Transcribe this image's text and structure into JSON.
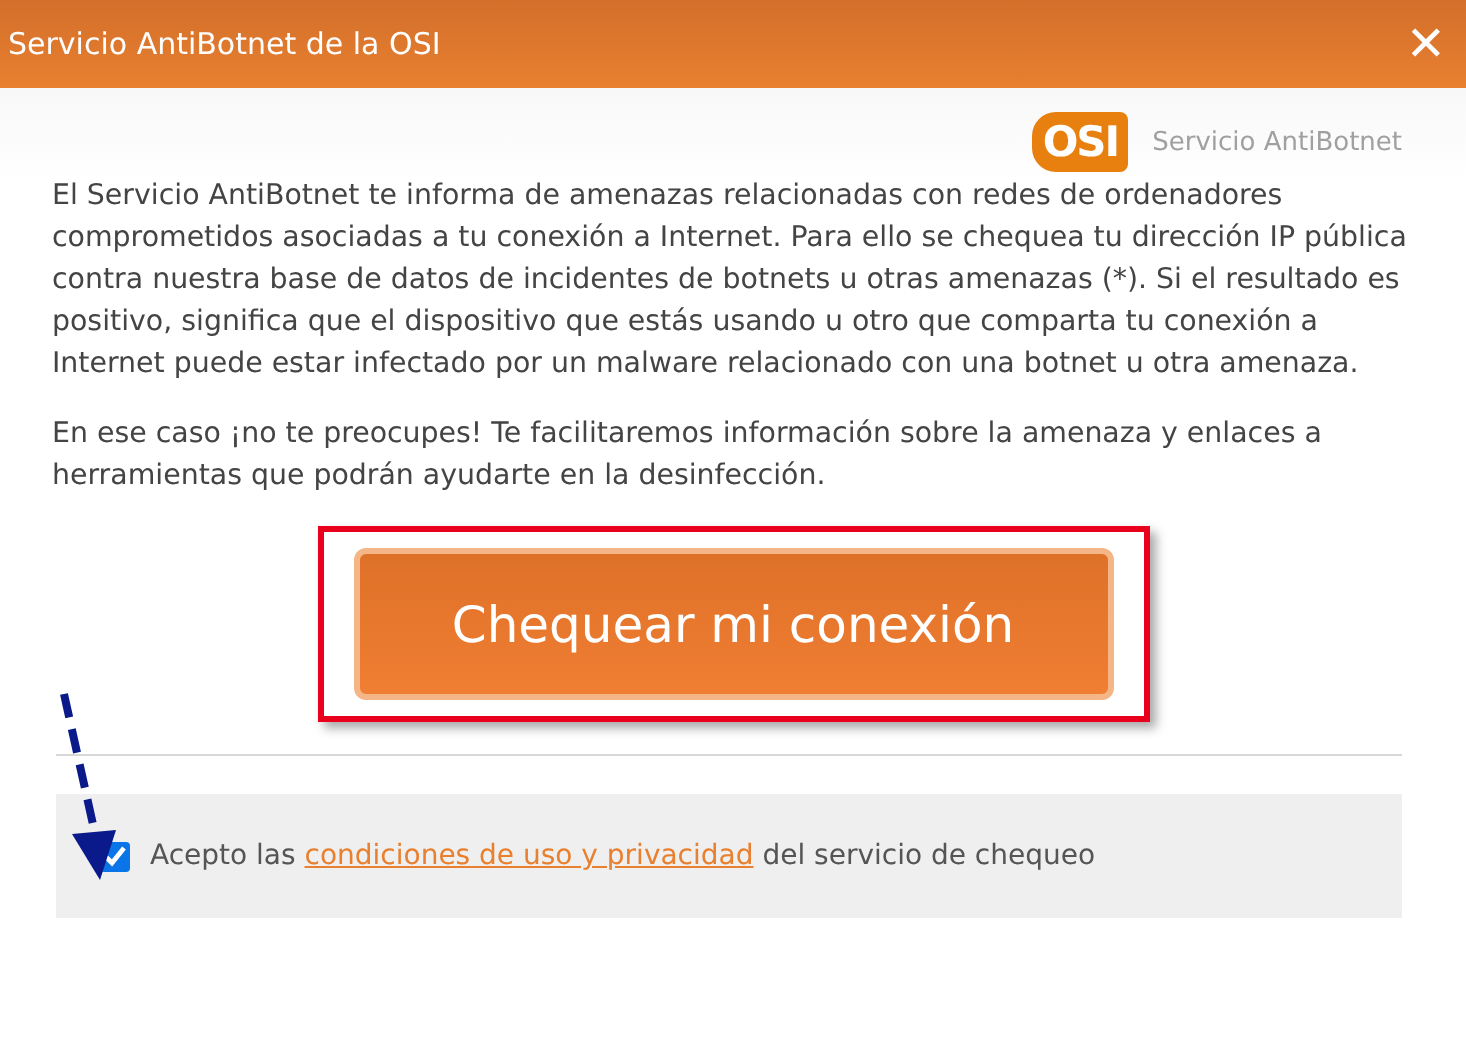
{
  "window": {
    "title": "Servicio AntiBotnet de la OSI",
    "close": "✕"
  },
  "brand": {
    "logo": "OSI",
    "name": "Servicio AntiBotnet"
  },
  "paragraphs": [
    "El Servicio AntiBotnet te informa de amenazas relacionadas con redes de ordenadores comprometidos asociadas a tu conexión a Internet. Para ello se chequea tu dirección IP pública contra nuestra base de datos de incidentes de botnets u otras amenazas (*). Si el resultado es positivo, significa que el dispositivo que estás usando u otro que comparta tu conexión a Internet puede estar infectado por un malware relacionado con una botnet u otra amenaza.",
    "En ese caso ¡no te preocupes! Te facilitaremos información sobre la amenaza y enlaces a herramientas que podrán ayudarte en la desinfección."
  ],
  "button": {
    "label": "Chequear mi conexión"
  },
  "consent": {
    "checked": true,
    "before": "Acepto las",
    "link": "condiciones de uso y privacidad",
    "after": "del servicio de chequeo"
  }
}
